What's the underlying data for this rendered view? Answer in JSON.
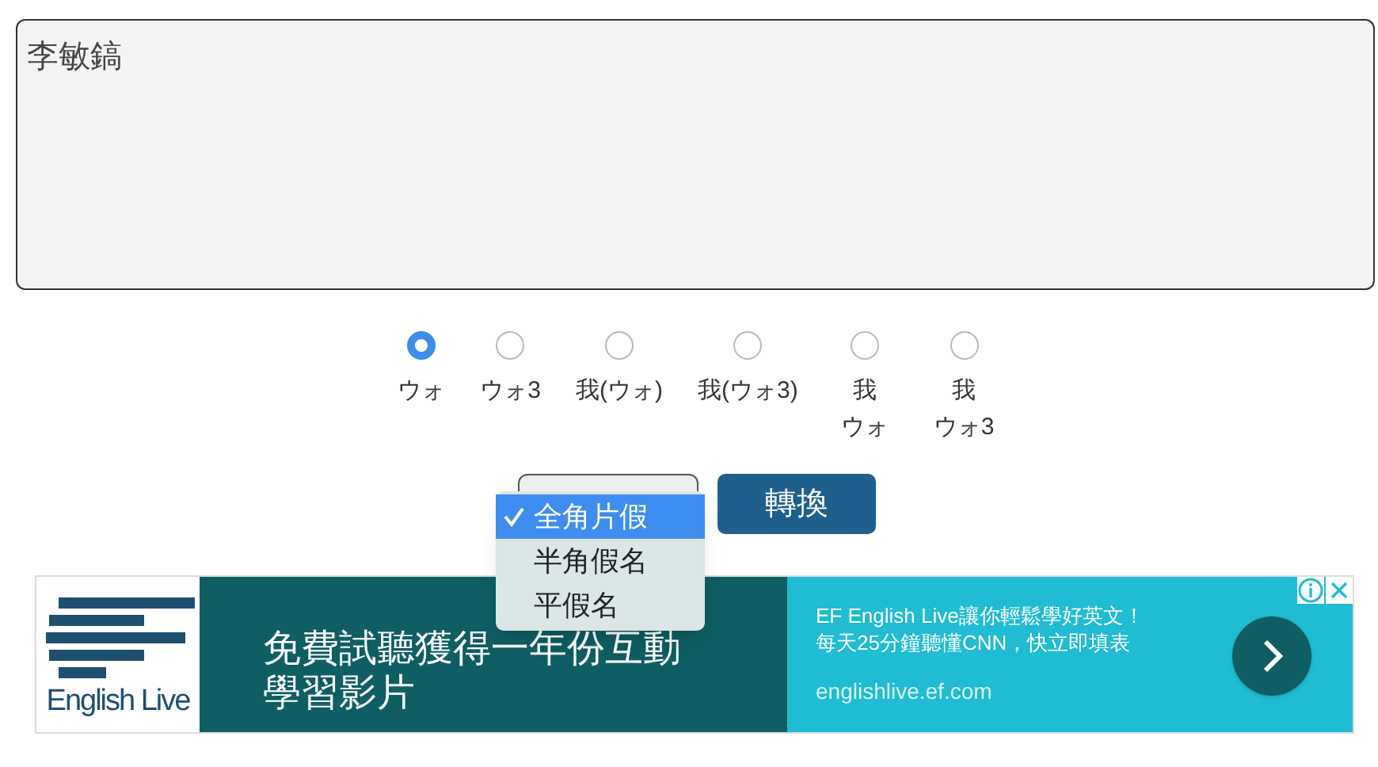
{
  "textarea": {
    "value": "李敏鎬"
  },
  "options": [
    {
      "label": "ウォ",
      "selected": true
    },
    {
      "label": "ウォ3",
      "selected": false
    },
    {
      "label": "我(ウォ)",
      "selected": false
    },
    {
      "label": "我(ウォ3)",
      "selected": false
    },
    {
      "label": "我ウォ",
      "selected": false
    },
    {
      "label": "我ウォ3",
      "selected": false
    }
  ],
  "select_menu": [
    {
      "label": "全角片假",
      "selected": true
    },
    {
      "label": "半角假名",
      "selected": false
    },
    {
      "label": "平假名",
      "selected": false
    }
  ],
  "convert_button": "轉換",
  "ad": {
    "logo_text": "English Live",
    "headline": "免費試聽獲得一年份互動學習影片",
    "body": "EF English Live讓你輕鬆學好英文！每天25分鐘聽懂CNN，快立即填表",
    "url": "englishlive.ef.com"
  }
}
